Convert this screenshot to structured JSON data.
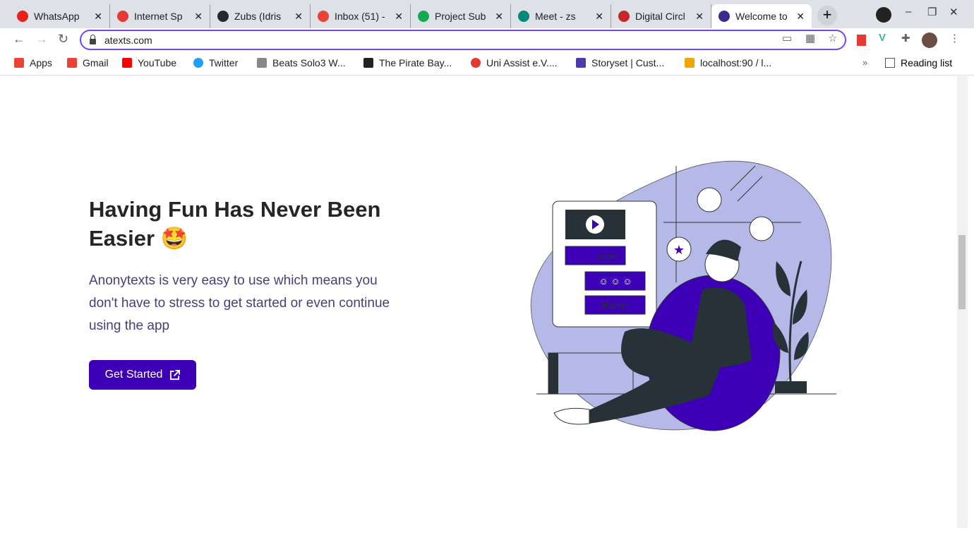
{
  "tabs": [
    {
      "title": "WhatsApp",
      "icon": "whatsapp-icon",
      "color": "#e8211d"
    },
    {
      "title": "Internet Sp",
      "icon": "speedometer-icon",
      "color": "#e53935"
    },
    {
      "title": "Zubs (Idris",
      "icon": "github-icon",
      "color": "#24292e"
    },
    {
      "title": "Inbox (51) -",
      "icon": "gmail-icon",
      "color": "#ea4335"
    },
    {
      "title": "Project Sub",
      "icon": "mongodb-leaf-icon",
      "color": "#13aa52"
    },
    {
      "title": "Meet - zs",
      "icon": "google-meet-icon",
      "color": "#00897b"
    },
    {
      "title": "Digital Circl",
      "icon": "circle-logo-icon",
      "color": "#c62828"
    },
    {
      "title": "Welcome to",
      "icon": "anonytexts-icon",
      "color": "#3d2a8f",
      "active": true
    }
  ],
  "toolbar": {
    "url": "atexts.com"
  },
  "bookmarks": [
    {
      "label": "Apps",
      "icon": "apps-grid-icon"
    },
    {
      "label": "Gmail",
      "icon": "gmail-icon"
    },
    {
      "label": "YouTube",
      "icon": "youtube-icon"
    },
    {
      "label": "Twitter",
      "icon": "twitter-icon"
    },
    {
      "label": "Beats Solo3 W...",
      "icon": "apple-icon"
    },
    {
      "label": "The Pirate Bay...",
      "icon": "pirate-ship-icon"
    },
    {
      "label": "Uni Assist e.V....",
      "icon": "uni-assist-icon"
    },
    {
      "label": "Storyset | Cust...",
      "icon": "storyset-icon"
    },
    {
      "label": "localhost:90 / l...",
      "icon": "phpmyadmin-icon"
    }
  ],
  "reading_list": "Reading list",
  "hero": {
    "title": "Having Fun Has Never Been Easier 🤩",
    "description": "Anonytexts is very easy to use which means you don't have to stress to get started or even continue using the app",
    "cta": "Get Started",
    "bubble_look": "Look!",
    "bubble_haha": "Hahah"
  },
  "colors": {
    "accent": "#3d00b7",
    "text": "#4b3c7a",
    "blob": "#b4b9e8"
  }
}
